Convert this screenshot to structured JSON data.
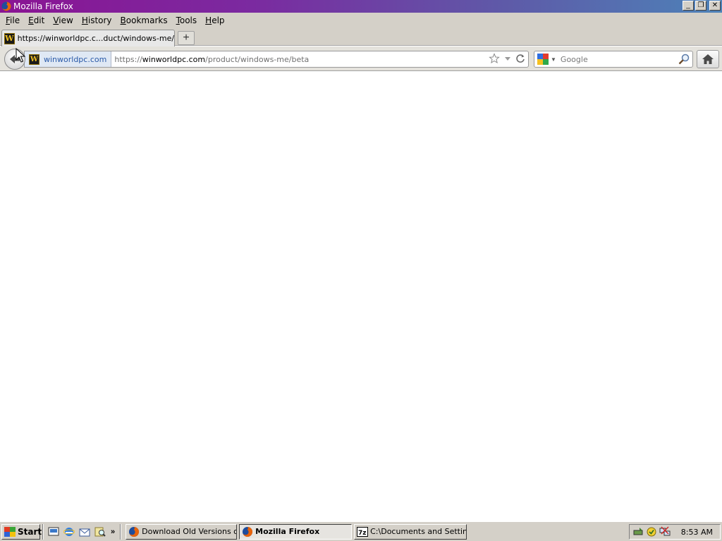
{
  "window": {
    "title": "Mozilla Firefox",
    "buttons": {
      "minimize": "_",
      "maximize": "❐",
      "close": "✕"
    }
  },
  "menubar": {
    "items": [
      {
        "label": "File"
      },
      {
        "label": "Edit"
      },
      {
        "label": "View"
      },
      {
        "label": "History"
      },
      {
        "label": "Bookmarks"
      },
      {
        "label": "Tools"
      },
      {
        "label": "Help"
      }
    ]
  },
  "tabs": {
    "active_label": "https://winworldpc.c...duct/windows-me/beta",
    "new_tab_label": "+"
  },
  "navbar": {
    "identity_label": "winworldpc.com",
    "url_prefix": "https://",
    "url_host": "winworldpc.com",
    "url_path": "/product/windows-me/beta",
    "search_placeholder": "Google",
    "favicon_letter": "W"
  },
  "taskbar": {
    "start_label": "Start",
    "chevron": "»",
    "tasks": [
      {
        "label": "Download Old Versions of...",
        "icon": "firefox-icon"
      },
      {
        "label": "Mozilla Firefox",
        "icon": "firefox-icon",
        "active": true
      },
      {
        "label": "C:\\Documents and Settin...",
        "icon": "7zip-icon"
      }
    ],
    "clock": "8:53 AM"
  },
  "colors": {
    "titlebar_start": "#8a1493",
    "titlebar_end": "#4d82b8",
    "chrome": "#d4d0c8",
    "identity_text": "#2a5aa8"
  }
}
